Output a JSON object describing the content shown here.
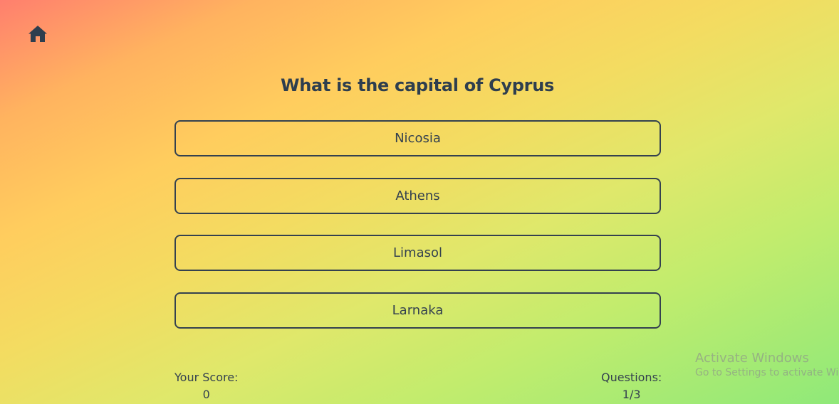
{
  "nav": {
    "home_icon": "home-icon"
  },
  "quiz": {
    "question": "What is the capital of Cyprus",
    "answers": [
      {
        "label": "Nicosia"
      },
      {
        "label": "Athens"
      },
      {
        "label": "Limasol"
      },
      {
        "label": "Larnaka"
      }
    ]
  },
  "footer": {
    "score_label": "Your Score:",
    "score_value": "0",
    "questions_label": "Questions:",
    "questions_value": "1/3"
  },
  "watermark": {
    "line1": "Activate Windows",
    "line2": "Go to Settings to activate Windows."
  },
  "colors": {
    "text": "#34414f",
    "gradient_start": "#ff7f6e",
    "gradient_mid": "#ffcd5e",
    "gradient_end": "#8fe979"
  }
}
